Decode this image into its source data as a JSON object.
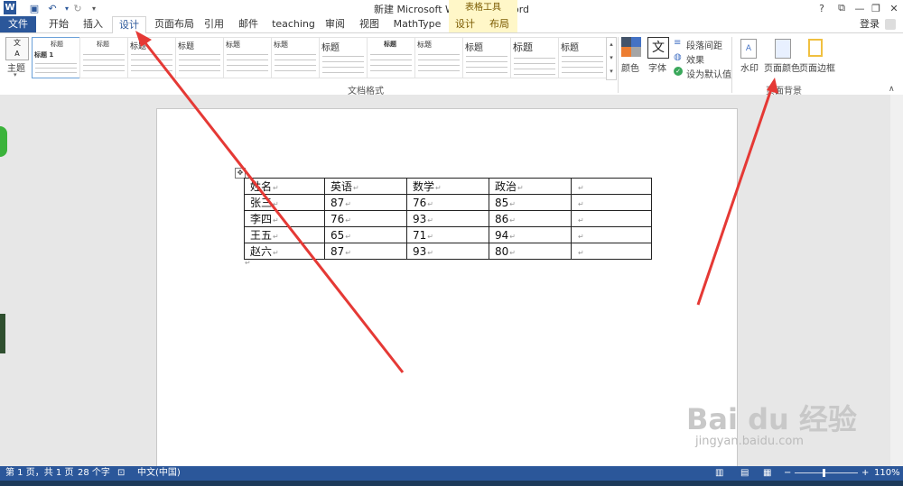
{
  "title_bar": {
    "title": "新建 Microsoft Word 文档 - Word",
    "table_tools": "表格工具",
    "login": "登录",
    "help": "?"
  },
  "tabs": {
    "file": "文件",
    "home": "开始",
    "insert": "插入",
    "design": "设计",
    "page_layout": "页面布局",
    "references": "引用",
    "mailings": "邮件",
    "teaching": "teaching",
    "review": "审阅",
    "view": "视图",
    "mathtype": "MathType",
    "table_design": "设计",
    "table_layout": "布局"
  },
  "ribbon": {
    "theme": "主题",
    "gallery_heading": "标题",
    "gallery_heading1": "标题 1",
    "colors": "颜色",
    "fonts": "字体",
    "paragraph_spacing": "段落间距",
    "effects": "效果",
    "set_default": "设为默认值",
    "watermark": "水印",
    "page_color": "页面颜色",
    "page_borders": "页面边框",
    "group_document_formatting": "文档格式",
    "group_page_background": "页面背景"
  },
  "table": {
    "headers": [
      "姓名",
      "英语",
      "数学",
      "政治",
      ""
    ],
    "rows": [
      [
        "张三",
        "87",
        "76",
        "85",
        ""
      ],
      [
        "李四",
        "76",
        "93",
        "86",
        ""
      ],
      [
        "王五",
        "65",
        "71",
        "94",
        ""
      ],
      [
        "赵六",
        "87",
        "93",
        "80",
        ""
      ]
    ]
  },
  "status": {
    "page": "第 1 页，共 1 页",
    "words": "28 个字",
    "language": "中文(中国)",
    "zoom": "110%"
  },
  "watermark": {
    "text": "Bai du 经验",
    "url": "jingyan.baidu.com"
  },
  "colors": {
    "accent": "#2b579a",
    "arrow": "#e53935",
    "table_tools": "#fff7c8"
  }
}
